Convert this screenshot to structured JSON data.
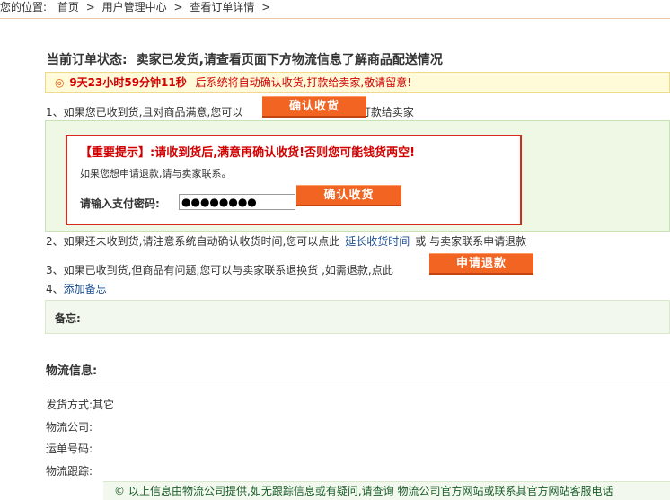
{
  "breadcrumb": {
    "prefix": "您的位置:",
    "items": [
      "首页",
      "用户管理中心",
      "查看订单详情"
    ],
    "sep": ">"
  },
  "status": {
    "label": "当前订单状态:",
    "message": "卖家已发货,请查看页面下方物流信息了解商品配送情况"
  },
  "countdown": {
    "icon": "clock-icon",
    "time": "9天23小时59分钟11秒",
    "text": "后系统将自动确认收货,打款给卖家,敬请留意!"
  },
  "step1": {
    "before": "1、如果您已收到货,且对商品满意,您可以",
    "button": "确认收货",
    "after": "打款给卖家"
  },
  "alert": {
    "title": "【重要提示】:请收到货后,满意再确认收货!否则您可能钱货两空!",
    "subtitle": "如果您想申请退款,请与卖家联系。",
    "password_label": "请输入支付密码:",
    "password_value": "●●●●●●●●",
    "button": "确认收货"
  },
  "step2": {
    "before": "2、如果还未收到货,请注意系统自动确认收货时间,您可以点此",
    "link": "延长收货时间",
    "after": "或 与卖家联系申请退款"
  },
  "step3": {
    "text": "3、如果已收到货,但商品有问题,您可以与卖家联系退换货 ,如需退款,点此",
    "button": "申请退款"
  },
  "step4": {
    "prefix": "4、",
    "link": "添加备忘"
  },
  "memo": {
    "label": "备忘:"
  },
  "logistics": {
    "title": "物流信息:",
    "ship_label": "发货方式:",
    "ship_value": "其它",
    "company_label": "物流公司:",
    "waybill_label": "运单号码:",
    "tracking_label": "物流跟踪:"
  },
  "footer": {
    "icon": "copyright-icon",
    "text": "以上信息由物流公司提供,如无跟踪信息或有疑问,请查询 物流公司官方网站或联系其官方网站客服电话"
  },
  "colors": {
    "button": "#f26422",
    "alert_border": "#d72a1b",
    "alert_text": "#d20000",
    "panel_bg": "#eef8e5",
    "link": "#1a4d8f"
  }
}
